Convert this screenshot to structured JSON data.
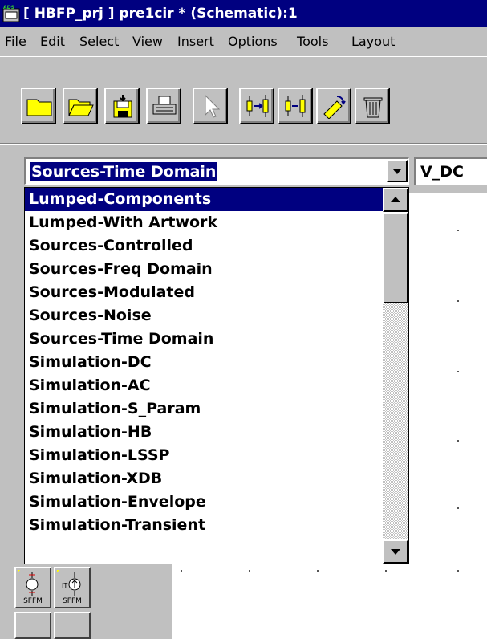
{
  "window": {
    "title": "[ HBFP_prj ] pre1cir * (Schematic):1",
    "icon": "ads-app-icon"
  },
  "menu": [
    {
      "label": "File",
      "key": "F",
      "rest": "ile"
    },
    {
      "label": "Edit",
      "key": "E",
      "rest": "dit"
    },
    {
      "label": "Select",
      "key": "S",
      "rest": "elect"
    },
    {
      "label": "View",
      "key": "V",
      "rest": "iew"
    },
    {
      "label": "Insert",
      "key": "I",
      "rest": "nsert"
    },
    {
      "label": "Options",
      "key": "O",
      "rest": "ptions"
    },
    {
      "label": "Tools",
      "key": "T",
      "rest": "ools"
    },
    {
      "label": "Layout",
      "key": "L",
      "rest": "ayout"
    }
  ],
  "toolbar": {
    "buttons": [
      "new-schematic-icon",
      "open-folder-icon",
      "save-icon",
      "print-icon",
      "select-arrow-icon",
      "insert-port-icon",
      "insert-component-icon",
      "rotate-icon",
      "delete-trash-icon"
    ]
  },
  "library": {
    "selected": "Sources-Time Domain",
    "component": "V_DC",
    "options": [
      "Lumped-Components",
      "Lumped-With Artwork",
      "Sources-Controlled",
      "Sources-Freq Domain",
      "Sources-Modulated",
      "Sources-Noise",
      "Sources-Time Domain",
      "Simulation-DC",
      "Simulation-AC",
      "Simulation-S_Param",
      "Simulation-HB",
      "Simulation-LSSP",
      "Simulation-XDB",
      "Simulation-Envelope",
      "Simulation-Transient"
    ],
    "highlighted_index": 0
  },
  "palette": {
    "items": [
      {
        "label": "SFFM",
        "icon": "sffm-source-icon"
      },
      {
        "label": "SFFM",
        "icon": "sffm-current-source-icon"
      }
    ]
  },
  "colors": {
    "titlebar": "#000080",
    "highlight": "#000080",
    "face": "#c0c0c0"
  }
}
